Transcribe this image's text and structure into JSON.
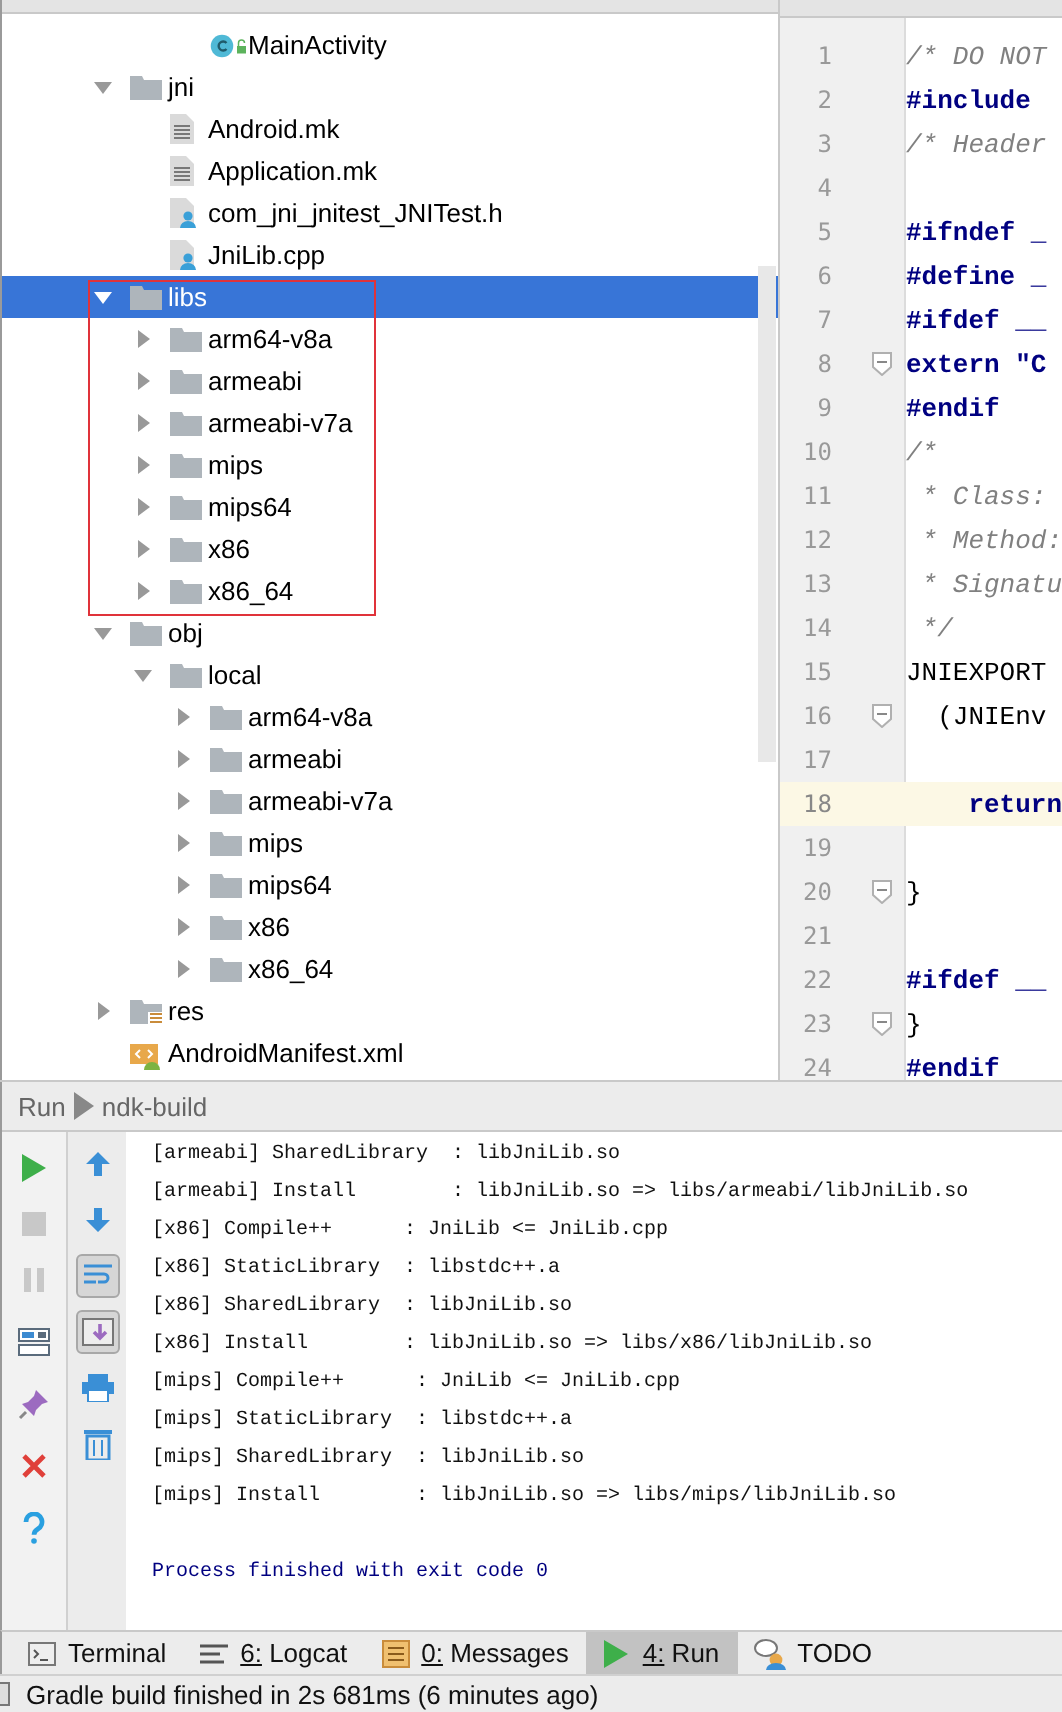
{
  "project_tree": [
    {
      "children": [
        {
          "children": [
            {
              "label": "MainActivity",
              "kind": "class"
            }
          ]
        }
      ]
    },
    {
      "label": "jni",
      "kind": "folder",
      "expanded": true,
      "selected": false,
      "children": [
        {
          "label": "Android.mk",
          "kind": "file"
        },
        {
          "label": "Application.mk",
          "kind": "file"
        },
        {
          "label": "com_jni_jnitest_JNITest.h",
          "kind": "source"
        },
        {
          "label": "JniLib.cpp",
          "kind": "source"
        }
      ]
    },
    {
      "label": "libs",
      "kind": "folder",
      "expanded": true,
      "selected": true,
      "boxed": true,
      "children": [
        {
          "label": "arm64-v8a",
          "kind": "folder",
          "expanded": false
        },
        {
          "label": "armeabi",
          "kind": "folder",
          "expanded": false
        },
        {
          "label": "armeabi-v7a",
          "kind": "folder",
          "expanded": false
        },
        {
          "label": "mips",
          "kind": "folder",
          "expanded": false
        },
        {
          "label": "mips64",
          "kind": "folder",
          "expanded": false
        },
        {
          "label": "x86",
          "kind": "folder",
          "expanded": false
        },
        {
          "label": "x86_64",
          "kind": "folder",
          "expanded": false
        }
      ]
    },
    {
      "label": "obj",
      "kind": "folder",
      "expanded": true,
      "selected": false,
      "children": [
        {
          "label": "local",
          "kind": "folder",
          "expanded": true,
          "children": [
            {
              "label": "arm64-v8a",
              "kind": "folder",
              "expanded": false
            },
            {
              "label": "armeabi",
              "kind": "folder",
              "expanded": false
            },
            {
              "label": "armeabi-v7a",
              "kind": "folder",
              "expanded": false
            },
            {
              "label": "mips",
              "kind": "folder",
              "expanded": false
            },
            {
              "label": "mips64",
              "kind": "folder",
              "expanded": false
            },
            {
              "label": "x86",
              "kind": "folder",
              "expanded": false
            },
            {
              "label": "x86_64",
              "kind": "folder",
              "expanded": false
            }
          ]
        }
      ]
    },
    {
      "label": "res",
      "kind": "res_folder",
      "expanded": false,
      "selected": false
    },
    {
      "label": "AndroidManifest.xml",
      "kind": "manifest"
    }
  ],
  "editor": {
    "lines": [
      {
        "number": "1",
        "text": "/* DO NOT",
        "kind": "comment"
      },
      {
        "number": "2",
        "text": "#include",
        "kind": "keyword"
      },
      {
        "number": "3",
        "text": "/* Header",
        "kind": "comment"
      },
      {
        "number": "4"
      },
      {
        "number": "5",
        "text": "#ifndef _",
        "kind": "keyword"
      },
      {
        "number": "6",
        "text": "#define _",
        "kind": "keyword"
      },
      {
        "number": "7",
        "text": "#ifdef __",
        "kind": "keyword"
      },
      {
        "number": "8",
        "text": "extern \"C",
        "kind": "keyword",
        "fold": true
      },
      {
        "number": "9",
        "text": "#endif",
        "kind": "keyword"
      },
      {
        "number": "10",
        "text": "/*",
        "kind": "comment"
      },
      {
        "number": "11",
        "text": " * Class:",
        "kind": "comment"
      },
      {
        "number": "12",
        "text": " * Method:",
        "kind": "comment"
      },
      {
        "number": "13",
        "text": " * Signatu",
        "kind": "comment"
      },
      {
        "number": "14",
        "text": " */",
        "kind": "comment"
      },
      {
        "number": "15",
        "text": "JNIEXPORT",
        "kind": "plain"
      },
      {
        "number": "16",
        "text": "  (JNIEnv",
        "kind": "plain",
        "fold": true
      },
      {
        "number": "17"
      },
      {
        "number": "18",
        "text": "    return",
        "kind": "keyword",
        "current": true
      },
      {
        "number": "19"
      },
      {
        "number": "20",
        "text": "}",
        "kind": "plain",
        "fold": true
      },
      {
        "number": "21"
      },
      {
        "number": "22",
        "text": "#ifdef __",
        "kind": "keyword"
      },
      {
        "number": "23",
        "text": "}",
        "kind": "plain",
        "fold": true
      },
      {
        "number": "24",
        "text": "#endif",
        "kind": "keyword"
      }
    ]
  },
  "run_panel": {
    "title": "Run",
    "configuration": "ndk-build",
    "toggles": [
      {
        "on": false
      },
      {
        "on": false
      },
      {
        "on": true
      },
      {
        "on": true
      },
      {
        "on": false
      },
      {
        "on": false
      }
    ],
    "output": [
      "[armeabi] SharedLibrary  : libJniLib.so",
      "[armeabi] Install        : libJniLib.so => libs/armeabi/libJniLib.so",
      "[x86] Compile++      : JniLib <= JniLib.cpp",
      "[x86] StaticLibrary  : libstdc++.a",
      "[x86] SharedLibrary  : libJniLib.so",
      "[x86] Install        : libJniLib.so => libs/x86/libJniLib.so",
      "[mips] Compile++      : JniLib <= JniLib.cpp",
      "[mips] StaticLibrary  : libstdc++.a",
      "[mips] SharedLibrary  : libJniLib.so",
      "[mips] Install        : libJniLib.so => libs/mips/libJniLib.so"
    ],
    "exit_message": "Process finished with exit code 0"
  },
  "tool_tabs": [
    {
      "label": "Terminal",
      "selected": false
    },
    {
      "label": "6: Logcat",
      "selected": false
    },
    {
      "label": "0: Messages",
      "selected": false
    },
    {
      "label": "4: Run",
      "selected": true
    },
    {
      "label": "TODO",
      "selected": false
    }
  ],
  "status_bar": {
    "message": "Gradle build finished in 2s 681ms (6 minutes ago)"
  }
}
